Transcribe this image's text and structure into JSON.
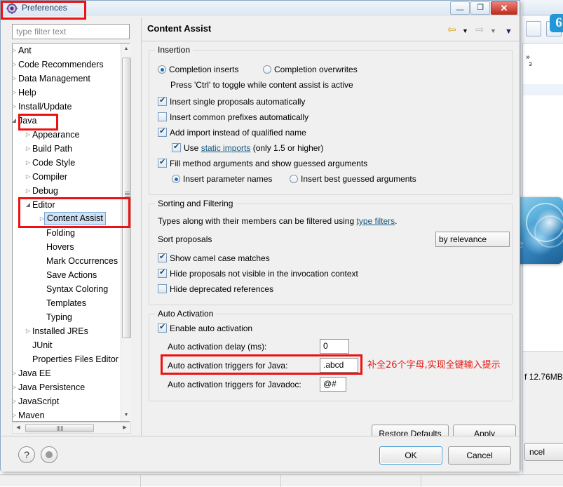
{
  "window": {
    "title": "Preferences",
    "icon": "preferences-gear-icon",
    "minimize_label": "—",
    "maximize_label": "❐",
    "close_label": "✕"
  },
  "filter": {
    "placeholder": "type filter text",
    "value": ""
  },
  "tree": {
    "items": [
      {
        "label": "Ant",
        "indent": 0,
        "arrow": "collapsed",
        "selected": false
      },
      {
        "label": "Code Recommenders",
        "indent": 0,
        "arrow": "collapsed",
        "selected": false
      },
      {
        "label": "Data Management",
        "indent": 0,
        "arrow": "collapsed",
        "selected": false
      },
      {
        "label": "Help",
        "indent": 0,
        "arrow": "collapsed",
        "selected": false
      },
      {
        "label": "Install/Update",
        "indent": 0,
        "arrow": "collapsed",
        "selected": false
      },
      {
        "label": "Java",
        "indent": 0,
        "arrow": "expanded",
        "selected": false
      },
      {
        "label": "Appearance",
        "indent": 1,
        "arrow": "collapsed",
        "selected": false
      },
      {
        "label": "Build Path",
        "indent": 1,
        "arrow": "collapsed",
        "selected": false
      },
      {
        "label": "Code Style",
        "indent": 1,
        "arrow": "collapsed",
        "selected": false
      },
      {
        "label": "Compiler",
        "indent": 1,
        "arrow": "collapsed",
        "selected": false
      },
      {
        "label": "Debug",
        "indent": 1,
        "arrow": "collapsed",
        "selected": false
      },
      {
        "label": "Editor",
        "indent": 1,
        "arrow": "expanded",
        "selected": false
      },
      {
        "label": "Content Assist",
        "indent": 2,
        "arrow": "collapsed",
        "selected": true
      },
      {
        "label": "Folding",
        "indent": 2,
        "arrow": "none",
        "selected": false
      },
      {
        "label": "Hovers",
        "indent": 2,
        "arrow": "none",
        "selected": false
      },
      {
        "label": "Mark Occurrences",
        "indent": 2,
        "arrow": "none",
        "selected": false
      },
      {
        "label": "Save Actions",
        "indent": 2,
        "arrow": "none",
        "selected": false
      },
      {
        "label": "Syntax Coloring",
        "indent": 2,
        "arrow": "none",
        "selected": false
      },
      {
        "label": "Templates",
        "indent": 2,
        "arrow": "none",
        "selected": false
      },
      {
        "label": "Typing",
        "indent": 2,
        "arrow": "none",
        "selected": false
      },
      {
        "label": "Installed JREs",
        "indent": 1,
        "arrow": "collapsed",
        "selected": false
      },
      {
        "label": "JUnit",
        "indent": 1,
        "arrow": "none",
        "selected": false
      },
      {
        "label": "Properties Files Editor",
        "indent": 1,
        "arrow": "none",
        "selected": false
      },
      {
        "label": "Java EE",
        "indent": 0,
        "arrow": "collapsed",
        "selected": false
      },
      {
        "label": "Java Persistence",
        "indent": 0,
        "arrow": "collapsed",
        "selected": false
      },
      {
        "label": "JavaScript",
        "indent": 0,
        "arrow": "collapsed",
        "selected": false
      },
      {
        "label": "Maven",
        "indent": 0,
        "arrow": "collapsed",
        "selected": false
      }
    ]
  },
  "page": {
    "title": "Content Assist",
    "nav": {
      "back": "back-arrow",
      "back_menu": "back-dropdown",
      "forward": "forward-arrow",
      "forward_menu": "forward-dropdown",
      "menu": "view-menu"
    },
    "insertion": {
      "legend": "Insertion",
      "radio_inserts": "Completion inserts",
      "radio_overwrites": "Completion overwrites",
      "radio_selected": "Completion inserts",
      "hint": "Press 'Ctrl' to toggle while content assist is active",
      "checks": [
        {
          "label": "Insert single proposals automatically",
          "checked": true
        },
        {
          "label": "Insert common prefixes automatically",
          "checked": false
        },
        {
          "label": "Add import instead of qualified name",
          "checked": true
        }
      ],
      "static_import": {
        "checked": true,
        "prefix": "Use ",
        "link": "static imports",
        "suffix": " (only 1.5 or higher)"
      },
      "fill_args": {
        "label": "Fill method arguments and show guessed arguments",
        "checked": true
      },
      "arg_radio_1": "Insert parameter names",
      "arg_radio_2": "Insert best guessed arguments",
      "arg_radio_selected": "Insert parameter names"
    },
    "sorting": {
      "legend": "Sorting and Filtering",
      "desc_prefix": "Types along with their members can be filtered using ",
      "desc_link": "type filters",
      "desc_suffix": ".",
      "sort_label": "Sort proposals",
      "sort_value": "by relevance",
      "checks": [
        {
          "label": "Show camel case matches",
          "checked": true
        },
        {
          "label": "Hide proposals not visible in the invocation context",
          "checked": true
        },
        {
          "label": "Hide deprecated references",
          "checked": false
        }
      ]
    },
    "auto_activation": {
      "legend": "Auto Activation",
      "enable": {
        "label": "Enable auto activation",
        "checked": true
      },
      "fields": [
        {
          "label": "Auto activation delay (ms):",
          "value": "0"
        },
        {
          "label": "Auto activation triggers for Java:",
          "value": ".abcd"
        },
        {
          "label": "Auto activation triggers for Javadoc:",
          "value": "@#"
        }
      ],
      "annotation": "补全26个字母,实现全键输入提示"
    },
    "restore_defaults": "Restore Defaults",
    "apply": "Apply"
  },
  "footer": {
    "help_icon": "?",
    "ok": "OK",
    "cancel": "Cancel"
  },
  "background": {
    "memory_text": "f 12.76MB",
    "cancel_button": "ncel",
    "gutter_marker": "»",
    "gutter_line": "3",
    "badge": "6"
  },
  "annotations": {
    "color": "#ee1111",
    "boxes": [
      "title-preferences",
      "tree-java",
      "tree-editor-content-assist",
      "java-trigger-field"
    ]
  },
  "colors": {
    "accent": "#1f6fb8",
    "selection": "#cfe1f5",
    "link": "#15587f",
    "annotation_red": "#ee1111",
    "dialog_bg": "#f0f0f0"
  }
}
